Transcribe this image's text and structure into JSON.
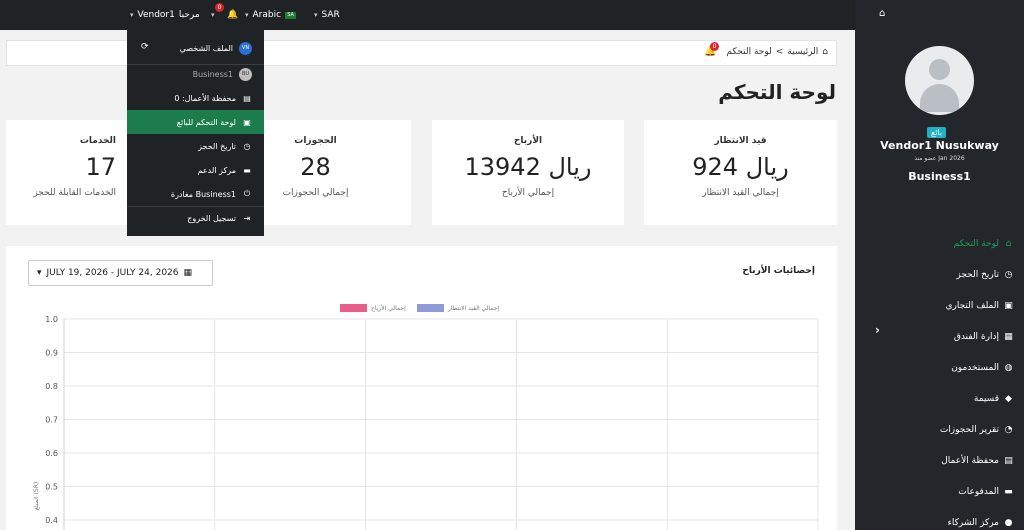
{
  "topbar": {
    "currency": "SAR",
    "language": "Arabic",
    "flag_text": "SA",
    "notif_count": "0",
    "greeting": "مرحبا",
    "user": "Vendor1"
  },
  "dropdown": {
    "profile": "الملف الشخصي",
    "avatar_initials": "VN",
    "business": "Business1",
    "business_initials": "BU",
    "wallet": "محفظة الأعمال: 0",
    "dashboard": "لوحة التحكم للبائع",
    "booking_history": "تاريخ الحجز",
    "support": "مركز الدعم",
    "leave": "مغادرة Business1",
    "logout": "تسجيل الخروج"
  },
  "breadcrumb": {
    "home": "الرئيسية",
    "separator": "<",
    "current": "لوحة التحكم",
    "notif_count": "0"
  },
  "page_title": "لوحة التحكم",
  "cards": {
    "pending": {
      "label": "قيد الانتظار",
      "value": "924 ريال",
      "sub": "إجمالي القيد الانتظار"
    },
    "earnings": {
      "label": "الأرباح",
      "value": "13942 ريال",
      "sub": "إجمالي الأرباح"
    },
    "bookings": {
      "label": "الحجوزات",
      "value": "28",
      "sub": "إجمالي الحجوزات"
    },
    "services": {
      "label": "الخدمات",
      "value": "17",
      "sub": "الخدمات القابلة للحجز"
    }
  },
  "panel": {
    "title": "إحصائيات الأرباح",
    "date_range": "JULY 19, 2026  -  JULY 24, 2026"
  },
  "sidebar": {
    "role": "بائع",
    "name": "Vendor1 Nusukway",
    "since": "عضو منذ Jan 2026",
    "business": "Business1",
    "items": [
      {
        "label": "لوحة التحكم",
        "icon": "⌂"
      },
      {
        "label": "تاريخ الحجز",
        "icon": "◷"
      },
      {
        "label": "الملف التجاري",
        "icon": "▣"
      },
      {
        "label": "إدارة الفندق",
        "icon": "▦"
      },
      {
        "label": "المستخدمون",
        "icon": "◍"
      },
      {
        "label": "قسيمة",
        "icon": "◆"
      },
      {
        "label": "تقرير الحجوزات",
        "icon": "◔"
      },
      {
        "label": "محفظة الأعمال",
        "icon": "▤"
      },
      {
        "label": "المدفوعات",
        "icon": "▬"
      },
      {
        "label": "مركز الشركاء",
        "icon": "●"
      }
    ]
  },
  "colors": {
    "earnings_series": "#e8608a",
    "pending_series": "#8e9bd8",
    "active_green": "#1f9d55",
    "dark_bg": "#202326"
  },
  "chart_data": {
    "type": "line",
    "series": [
      {
        "name": "إجمالي الأرباح",
        "values": []
      },
      {
        "name": "إجمالي القيد الانتظار",
        "values": []
      }
    ],
    "yticks": [
      "1.0",
      "0.9",
      "0.8",
      "0.7",
      "0.6",
      "0.5",
      "0.4"
    ],
    "ylim": [
      0,
      1
    ],
    "ylabel": "المبلغ (SR)",
    "grid": true,
    "legend": "top-center"
  }
}
